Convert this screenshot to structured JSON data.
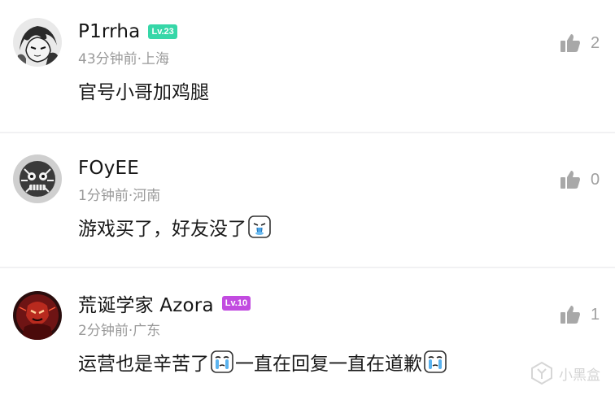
{
  "comments": [
    {
      "username": "P1rrha",
      "level": "Lv.23",
      "level_color": "#36d7a8",
      "meta": "43分钟前·上海",
      "content_parts": [
        "官号小哥加鸡腿"
      ],
      "likes": "2",
      "avatar_icon": "anime-character-avatar"
    },
    {
      "username": "FOyEE",
      "level": "",
      "meta": "1分钟前·河南",
      "content_parts": [
        "游戏买了，好友没了"
      ],
      "emoji": [
        "crying-emoji"
      ],
      "likes": "0",
      "avatar_icon": "skull-face-avatar"
    },
    {
      "username": "荒诞学家 Azora",
      "level": "Lv.10",
      "level_color": "#c24be0",
      "meta": "2分钟前·广东",
      "content_parts": [
        "运营也是辛苦了",
        "一直在回复一直在道歉"
      ],
      "emoji": [
        "tears-emoji",
        "tears-emoji"
      ],
      "likes": "1",
      "avatar_icon": "red-warrior-avatar"
    }
  ],
  "watermark": {
    "text": "小黑盒",
    "icon": "xiaoheihe-logo-icon"
  },
  "colors": {
    "meta_gray": "#9a9a9a",
    "like_gray": "#a0a0a0",
    "divider": "#f1f1f3"
  }
}
